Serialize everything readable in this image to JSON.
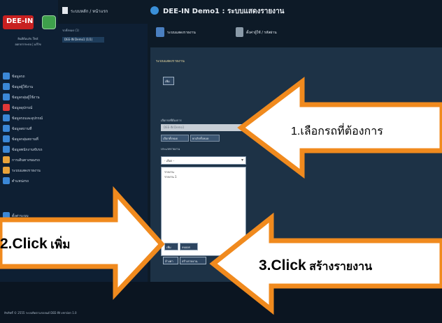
{
  "app": {
    "title": "DEE-IN Demo1 : ระบบแสดงรายงาน",
    "breadcrumb": "ระบบหลัก / หน้าแรก",
    "logo_text": "DEE-IN"
  },
  "user": {
    "line1": "ยินดีต้อนรับ Test",
    "line2": "ออกจากระบบ | แก้ไข"
  },
  "sidebar": {
    "items": [
      {
        "label": "ข้อมูลรถ",
        "color": "#3b87d6"
      },
      {
        "label": "ข้อมูลผู้ใช้งาน",
        "color": "#3b87d6"
      },
      {
        "label": "ข้อมูลกลุ่มผู้ใช้งาน",
        "color": "#3b87d6"
      },
      {
        "label": "ข้อมูลอุปกรณ์",
        "color": "#e03838"
      },
      {
        "label": "ข้อมูลรถและอุปกรณ์",
        "color": "#3b87d6"
      },
      {
        "label": "ข้อมูลสถานที่",
        "color": "#3b87d6"
      },
      {
        "label": "ข้อมูลกลุ่มสถานที่",
        "color": "#3b87d6"
      },
      {
        "label": "ข้อมูลพนักงานขับรถ",
        "color": "#3b87d6"
      },
      {
        "label": "การเดินทางของรถ",
        "color": "#e9a33a"
      },
      {
        "label": "ระบบแสดงรายงาน",
        "color": "#e9a33a"
      },
      {
        "label": "ตำแหน่งรถ",
        "color": "#3b87d6"
      }
    ],
    "last_item": "ตั้งค่าระบบ"
  },
  "list_panel": {
    "label": "รถทั้งหมด (1)",
    "selected": "DEE-IN Demo1 (1/1)"
  },
  "tabs": [
    {
      "label": "ระบบแสดงรายงาน"
    },
    {
      "label": "ตั้งค่าผู้ใช้ / รหัสผ่าน"
    }
  ],
  "workspace": {
    "title": "ระบบแสดงรายงาน",
    "add_button": "เพิ่ม",
    "car_label": "เลือกรถที่ต้องการ",
    "car_value": "DEE-IN Demo1",
    "select_all": "เลือกทั้งหมด",
    "clear_all": "ยกเลิกทั้งหมด",
    "report_label": "ประเภทรายงาน",
    "report_select": "- เลือก -",
    "report_options": [
      "รายงาน",
      "รายงาน 1"
    ],
    "btn_add": "เพิ่ม",
    "btn_delete": "ลบออก",
    "btn_reset": "ล้างค่า",
    "btn_create": "สร้างรายงาน"
  },
  "footer": {
    "text": "ลิขสิทธิ์ © 2555 ระบบติดตามรถยนต์ DEE-IN version 1.0"
  },
  "annotations": {
    "arrow1": "1.เลือกรถที่ต้องการ",
    "arrow2_en": "2.Click",
    "arrow2_th": "เพิ่ม",
    "arrow3_en": "3.Click",
    "arrow3_th": "สร้างรายงาน",
    "arrow_fill": "#ffffff",
    "arrow_stroke": "#f08a1e"
  }
}
